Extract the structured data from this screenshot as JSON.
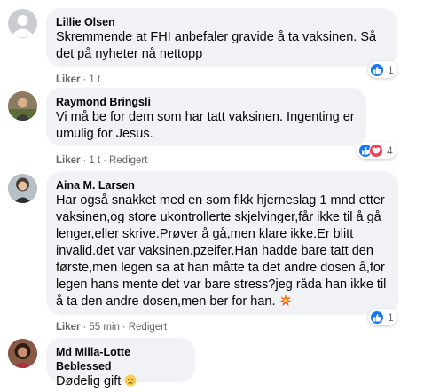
{
  "comments": [
    {
      "author": "Lillie Olsen",
      "text": "Skremmende at FHI anbefaler gravide å ta vaksinen. Så det på nyheter nå nettopp",
      "like_label": "Liker",
      "time": "1 t",
      "reaction_count": "1"
    },
    {
      "author": "Raymond Bringsli",
      "text": "Vi må be for dem som har tatt vaksinen. Ingenting er umulig for Jesus.",
      "like_label": "Liker",
      "time": "1 t",
      "edited": "Redigert",
      "reaction_count": "4"
    },
    {
      "author": "Aina M. Larsen",
      "text": "Har også snakket med en som fikk hjerneslag 1 mnd etter vaksinen,og store ukontrollerte skjelvinger,får ikke til å gå lenger,eller skrive.Prøver å gå,men klare ikke.Er blitt invalid.det var vaksinen.pzeifer.Han hadde bare tatt den første,men legen sa at han måtte ta det andre dosen å,for legen hans mente det var bare stress?jeg råda han ikke til å ta den andre dosen,men ber for han.",
      "emoji": "collision-emoji",
      "like_label": "Liker",
      "time": "55 min",
      "edited": "Redigert",
      "reaction_count": "1"
    },
    {
      "author": "Md Milla-Lotte Beblessed",
      "text": "Dødelig gift",
      "emoji": "crying-face-emoji"
    }
  ],
  "colors": {
    "bubble": "#f0f2f5",
    "meta": "#65676b",
    "like": "#1877f2",
    "love": "#f33e58"
  }
}
